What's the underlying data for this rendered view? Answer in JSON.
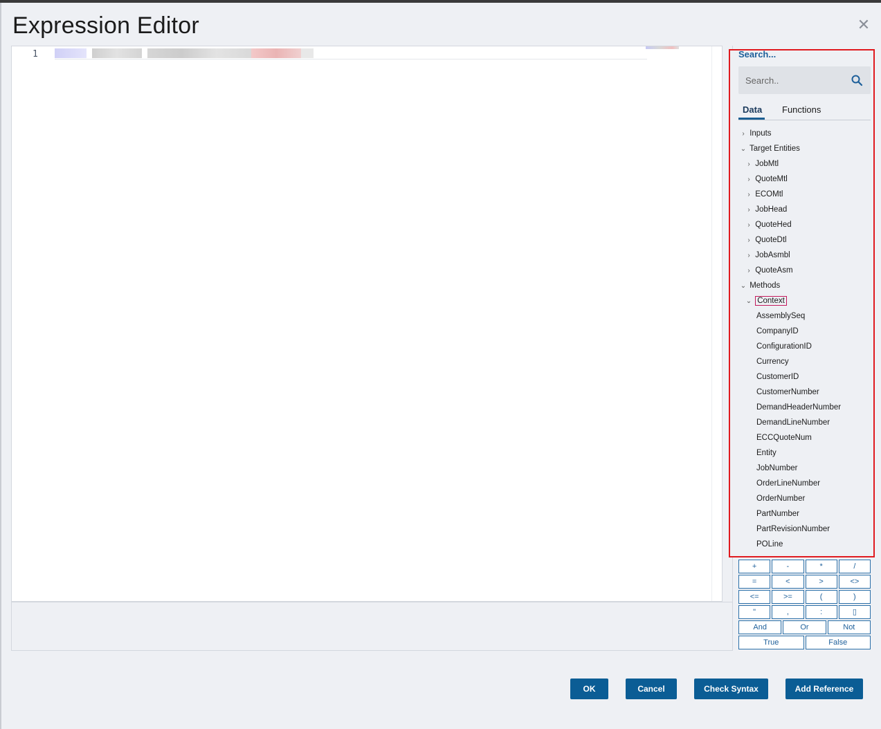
{
  "dialog": {
    "title": "Expression Editor",
    "close_glyph": "✕"
  },
  "editor": {
    "line_number": "1"
  },
  "side_panel": {
    "header": "Search...",
    "search_placeholder": "Search..",
    "tabs": [
      {
        "label": "Data",
        "active": true
      },
      {
        "label": "Functions",
        "active": false
      }
    ],
    "tree": [
      {
        "label": "Inputs",
        "expanded": false
      },
      {
        "label": "Target Entities",
        "expanded": true
      },
      {
        "label": "JobMtl",
        "expanded": false
      },
      {
        "label": "QuoteMtl",
        "expanded": false
      },
      {
        "label": "ECOMtl",
        "expanded": false
      },
      {
        "label": "JobHead",
        "expanded": false
      },
      {
        "label": "QuoteHed",
        "expanded": false
      },
      {
        "label": "QuoteDtl",
        "expanded": false
      },
      {
        "label": "JobAsmbl",
        "expanded": false
      },
      {
        "label": "QuoteAsm",
        "expanded": false
      },
      {
        "label": "Methods",
        "expanded": true
      },
      {
        "label": "Context",
        "expanded": true,
        "highlighted": true
      },
      {
        "label": "AssemblySeq"
      },
      {
        "label": "CompanyID"
      },
      {
        "label": "ConfigurationID"
      },
      {
        "label": "Currency"
      },
      {
        "label": "CustomerID"
      },
      {
        "label": "CustomerNumber"
      },
      {
        "label": "DemandHeaderNumber"
      },
      {
        "label": "DemandLineNumber"
      },
      {
        "label": "ECCQuoteNum"
      },
      {
        "label": "Entity"
      },
      {
        "label": "JobNumber"
      },
      {
        "label": "OrderLineNumber"
      },
      {
        "label": "OrderNumber"
      },
      {
        "label": "PartNumber"
      },
      {
        "label": "PartRevisionNumber"
      },
      {
        "label": "POLine"
      }
    ]
  },
  "keypad": {
    "rows": [
      [
        "+",
        "-",
        "*",
        "/"
      ],
      [
        "=",
        "<",
        ">",
        "<>"
      ],
      [
        "<=",
        ">=",
        "(",
        ")"
      ],
      [
        "\"",
        ",",
        ":",
        "▯"
      ],
      [
        "And",
        "Or",
        "Not"
      ],
      [
        "True",
        "False"
      ]
    ]
  },
  "buttons": {
    "ok": "OK",
    "cancel": "Cancel",
    "check_syntax": "Check Syntax",
    "add_reference": "Add Reference"
  },
  "colors": {
    "primary_button": "#0b5d95",
    "highlight_border": "#e0191e",
    "link": "#1d5f9a"
  }
}
